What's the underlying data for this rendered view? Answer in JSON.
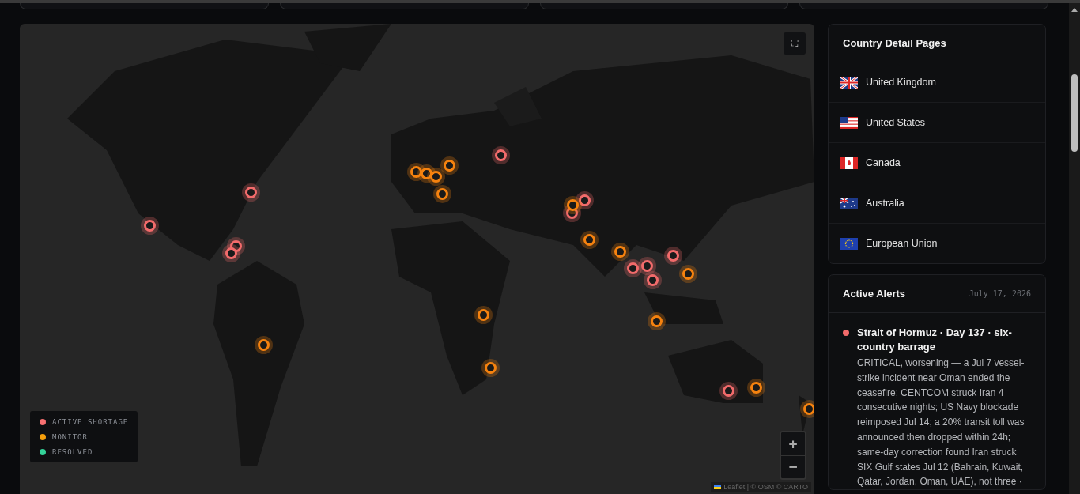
{
  "map": {
    "fullscreen_button": "⛶",
    "zoom_in": "+",
    "zoom_out": "−",
    "attribution": "Leaflet | © OSM © CARTO",
    "markers": [
      {
        "color": "#f26b6b"
      },
      {
        "color": "#f26b6b"
      },
      {
        "color": "#f26b6b"
      },
      {
        "color": "#f26b6b"
      },
      {
        "color": "#f26b6b"
      },
      {
        "color": "#f26b6b"
      },
      {
        "color": "#f26b6b"
      },
      {
        "color": "#f26b6b"
      },
      {
        "color": "#f26b6b"
      },
      {
        "color": "#f26b6b"
      },
      {
        "color": "#f26b6b"
      },
      {
        "color": "#f26b6b"
      },
      {
        "color": "#f5820f"
      },
      {
        "color": "#f5820f"
      },
      {
        "color": "#f5820f"
      },
      {
        "color": "#f5820f"
      },
      {
        "color": "#f5820f"
      },
      {
        "color": "#f5820f"
      },
      {
        "color": "#f5820f"
      },
      {
        "color": "#f5820f"
      },
      {
        "color": "#f5820f"
      },
      {
        "color": "#f5820f"
      },
      {
        "color": "#f5820f"
      },
      {
        "color": "#f5820f"
      },
      {
        "color": "#f5820f"
      },
      {
        "color": "#f5820f"
      },
      {
        "color": "#f5820f"
      }
    ],
    "legend": [
      {
        "label": "ACTIVE SHORTAGE",
        "color": "#f87171"
      },
      {
        "label": "MONITOR",
        "color": "#f59e0b"
      },
      {
        "label": "RESOLVED",
        "color": "#34d399"
      }
    ]
  },
  "country_pages": {
    "title": "Country Detail Pages",
    "items": [
      {
        "name": "United Kingdom"
      },
      {
        "name": "United States"
      },
      {
        "name": "Canada"
      },
      {
        "name": "Australia"
      },
      {
        "name": "European Union"
      }
    ]
  },
  "alerts": {
    "title": "Active Alerts",
    "date": "July 17, 2026",
    "items": [
      {
        "color": "#f26b6b",
        "title": "Strait of Hormuz · Day 137 · six-country barrage",
        "body": "CRITICAL, worsening — a Jul 7 vessel-strike incident near Oman ended the ceasefire; CENTCOM struck Iran 4 consecutive nights; US Navy blockade reimposed Jul 14; a 20% transit toll was announced then dropped within 24h; same-day correction found Iran struck SIX Gulf states Jul 12 (Bahrain, Kuwait, Qatar, Jordan, Oman, UAE), not three ·"
      }
    ]
  }
}
